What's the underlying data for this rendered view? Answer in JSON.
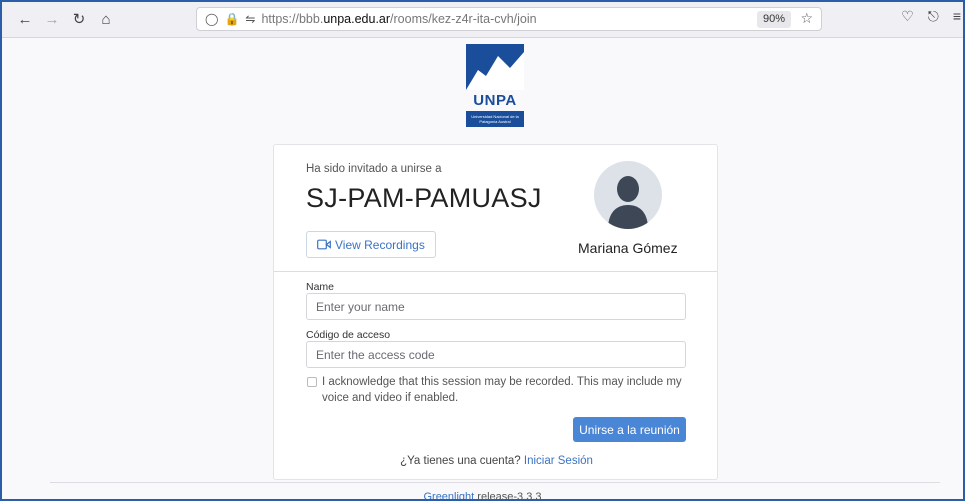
{
  "browser": {
    "url_prefix": "https://bbb.",
    "url_host": "unpa.edu.ar",
    "url_path": "/rooms/kez-z4r-ita-cvh/join",
    "zoom": "90%"
  },
  "logo": {
    "name": "UNPA",
    "subtitle": "Universidad Nacional de la Patagonia Austral"
  },
  "room": {
    "invited_text": "Ha sido invitado a unirse a",
    "name": "SJ-PAM-PAMUASJ",
    "view_recordings": "View Recordings",
    "owner": "Mariana Gómez"
  },
  "form": {
    "name_label": "Name",
    "name_placeholder": "Enter your name",
    "code_label": "Código de acceso",
    "code_placeholder": "Enter the access code",
    "acknowledge": "I acknowledge that this session may be recorded. This may include my voice and video if enabled.",
    "join_button": "Unirse a la reunión",
    "account_question": "¿Ya tienes una cuenta?",
    "sign_in": "Iniciar Sesión"
  },
  "footer": {
    "link": "Greenlight",
    "release": "release-3.3.3"
  },
  "colors": {
    "accent": "#4a86d6",
    "brand": "#1a4d9a"
  }
}
